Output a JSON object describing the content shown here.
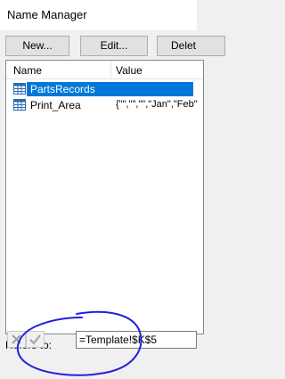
{
  "window": {
    "title": "Name Manager"
  },
  "toolbar": {
    "new_label": "New...",
    "edit_label": "Edit...",
    "delete_label": "Delet"
  },
  "list": {
    "columns": {
      "name": "Name",
      "value": "Value"
    },
    "rows": [
      {
        "name": "PartsRecords",
        "value": "",
        "selected": true
      },
      {
        "name": "Print_Area",
        "value": "{\"\",\"\",\"\",\"Jan\",\"Feb\"",
        "selected": false
      }
    ]
  },
  "refers_to": {
    "label": "Refers to:",
    "value": "=Template!$K$5"
  },
  "colors": {
    "selection": "#0078d7",
    "annotation_ink": "#1f1fe0",
    "table_icon": "#2b6cb0"
  },
  "icons": [
    "table-icon",
    "cancel-icon",
    "check-icon"
  ]
}
